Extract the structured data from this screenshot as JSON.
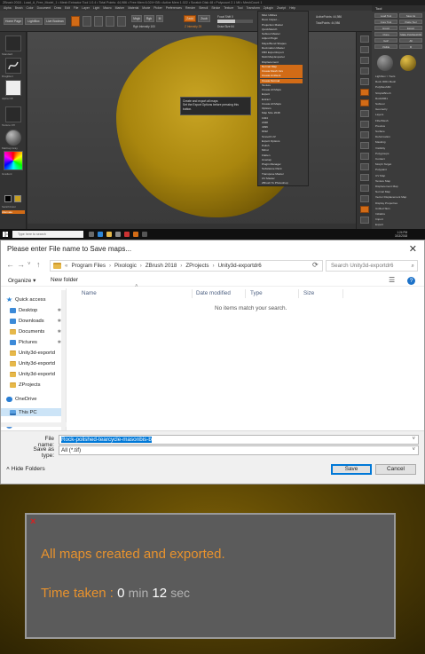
{
  "zbrush": {
    "title": "ZBrush 2018 - Load_A_Free_Model_1 • Mesh Extractor Tool 1.0.4 • Total Points: 44,986 • Free Mem 6.024+GB • Active Mem 1.022 • Scratch Disk 48 • Polycount 2.1 Mil • MeshCount 1",
    "menus": [
      "Alpha",
      "Brush",
      "Color",
      "Document",
      "Draw",
      "Edit",
      "File",
      "Layer",
      "Light",
      "Macro",
      "Marker",
      "Material",
      "Movie",
      "Picker",
      "Preferences",
      "Render",
      "Stencil",
      "Stroke",
      "Texture",
      "Tool",
      "Transform",
      "Zplugin",
      "Zscript",
      "Help"
    ],
    "toolbar": {
      "home_page": "Home Page",
      "lightbox": "LightBox",
      "live_boolean": "Live Boolean",
      "mrgb": "Mrgb",
      "rgb": "Rgb",
      "m": "M",
      "zadd": "Zadd",
      "zsub": "Zsub",
      "focal_shift": "Focal Shift 0",
      "draw_size": "Draw Size 64",
      "rgb_intensity": "Rgb Intensity 100",
      "z_intensity": "Z Intensity 25",
      "active_points": "ActivePoints: 44,986",
      "total_points": "TotalPoints: 44,986",
      "dynamic": "Dynamic"
    },
    "left_shelf": {
      "brush_label": "Standard",
      "stroke_label": "DragRect",
      "alpha_label": "Alpha Off",
      "texture_label": "Texture Off",
      "material_label": "MatCap Gray",
      "gradient_label": "Gradient",
      "switch_color": "SwitchColor",
      "alternate": "Alternate"
    },
    "zplugin_menu": {
      "items": [
        "Misc Utilities",
        "Deco Inspec...",
        "Projection Master",
        "QuickSketch",
        "Subtool Master",
        "Adjust Plugin",
        "Maya Blend Shapes",
        "Decimation Master",
        "FBX ExportImport",
        "Multi Map Exporter",
        "Displacement",
        "Normal Map",
        "Create Mesh Uvs",
        "Create Ambient",
        "Create Normal",
        "Texture",
        "Create All Maps",
        "Export",
        "Extract",
        "Create All Maps",
        "Options",
        "Map Size 2048",
        "1024",
        "2048",
        "4096",
        "8192",
        "Smooth UV",
        "Export Options",
        "Polish",
        "Mirror",
        "Flatten",
        "Unwrap",
        "Plugin Manager",
        "Substance Paint",
        "Transpose Master",
        "UV Master",
        "ZBrush To Photoshop"
      ],
      "highlighted_items": [
        "Normal Map",
        "Create Mesh Uvs",
        "Create Ambient",
        "Create Normal"
      ]
    },
    "tooltip": {
      "line1": "Create and export all maps",
      "line2": "Set the Export Options before pressing this",
      "line3": "button."
    },
    "tool_palette": {
      "header": "Tool",
      "items": [
        "Load Tool",
        "Save As",
        "Copy Tool",
        "Paste Tool",
        "Import",
        "Export",
        "Clone",
        "Make PolyMesh3D",
        "GoZ",
        "All",
        "Visible",
        "R",
        "Lightbox > Tools",
        "Rock 0061 Mesh",
        "PolyMesh3D",
        "SimpleBrush",
        "Rock0061",
        "Subtool",
        "Geometry",
        "Layers",
        "FiberMesh",
        "Preview",
        "Surface",
        "Deformation",
        "Masking",
        "Visibility",
        "Polygroups",
        "Contact",
        "Morph Target",
        "Polypaint",
        "UV Map",
        "Texture Map",
        "Displacement Map",
        "Normal Map",
        "Vector Displacement Map",
        "Display Properties",
        "Unified Skin",
        "Initialize",
        "Import",
        "Export"
      ]
    },
    "taskbar": {
      "search_placeholder": "Type here to search",
      "time": "1:24 PM",
      "date": "3/13/2018"
    }
  },
  "save_dialog": {
    "title": "Please enter File name to Save maps...",
    "address": {
      "segments": [
        "Program Files",
        "Pixologic",
        "ZBrush 2018",
        "ZProjects",
        "Unity3d-exportdr6"
      ]
    },
    "search_placeholder": "Search Unity3d-exportdr6",
    "commands": {
      "organize": "Organize ▾",
      "new_folder": "New folder"
    },
    "nav": {
      "quick_access": "Quick access",
      "items": [
        "Desktop",
        "Downloads",
        "Documents",
        "Pictures",
        "Unity3d-exportd",
        "Unity3d-exportd",
        "Unity3d-exportd",
        "ZProjects"
      ],
      "onedrive": "OneDrive",
      "this_pc": "This PC",
      "network": "Network"
    },
    "columns": [
      "Name",
      "Date modified",
      "Type",
      "Size"
    ],
    "empty_message": "No items match your search.",
    "file_name_label": "File name:",
    "file_name_value": "Rock-polished-tearcycle-masonbis-b",
    "save_as_type_label": "Save as type:",
    "save_as_type_value": "All (*.tif)",
    "hide_folders": "Hide Folders",
    "save_button": "Save",
    "cancel_button": "Cancel"
  },
  "notice": {
    "message": "All maps created and exported.",
    "time_label": "Time taken :",
    "minutes": "0",
    "min_unit": "min",
    "seconds": "12",
    "sec_unit": "sec"
  }
}
